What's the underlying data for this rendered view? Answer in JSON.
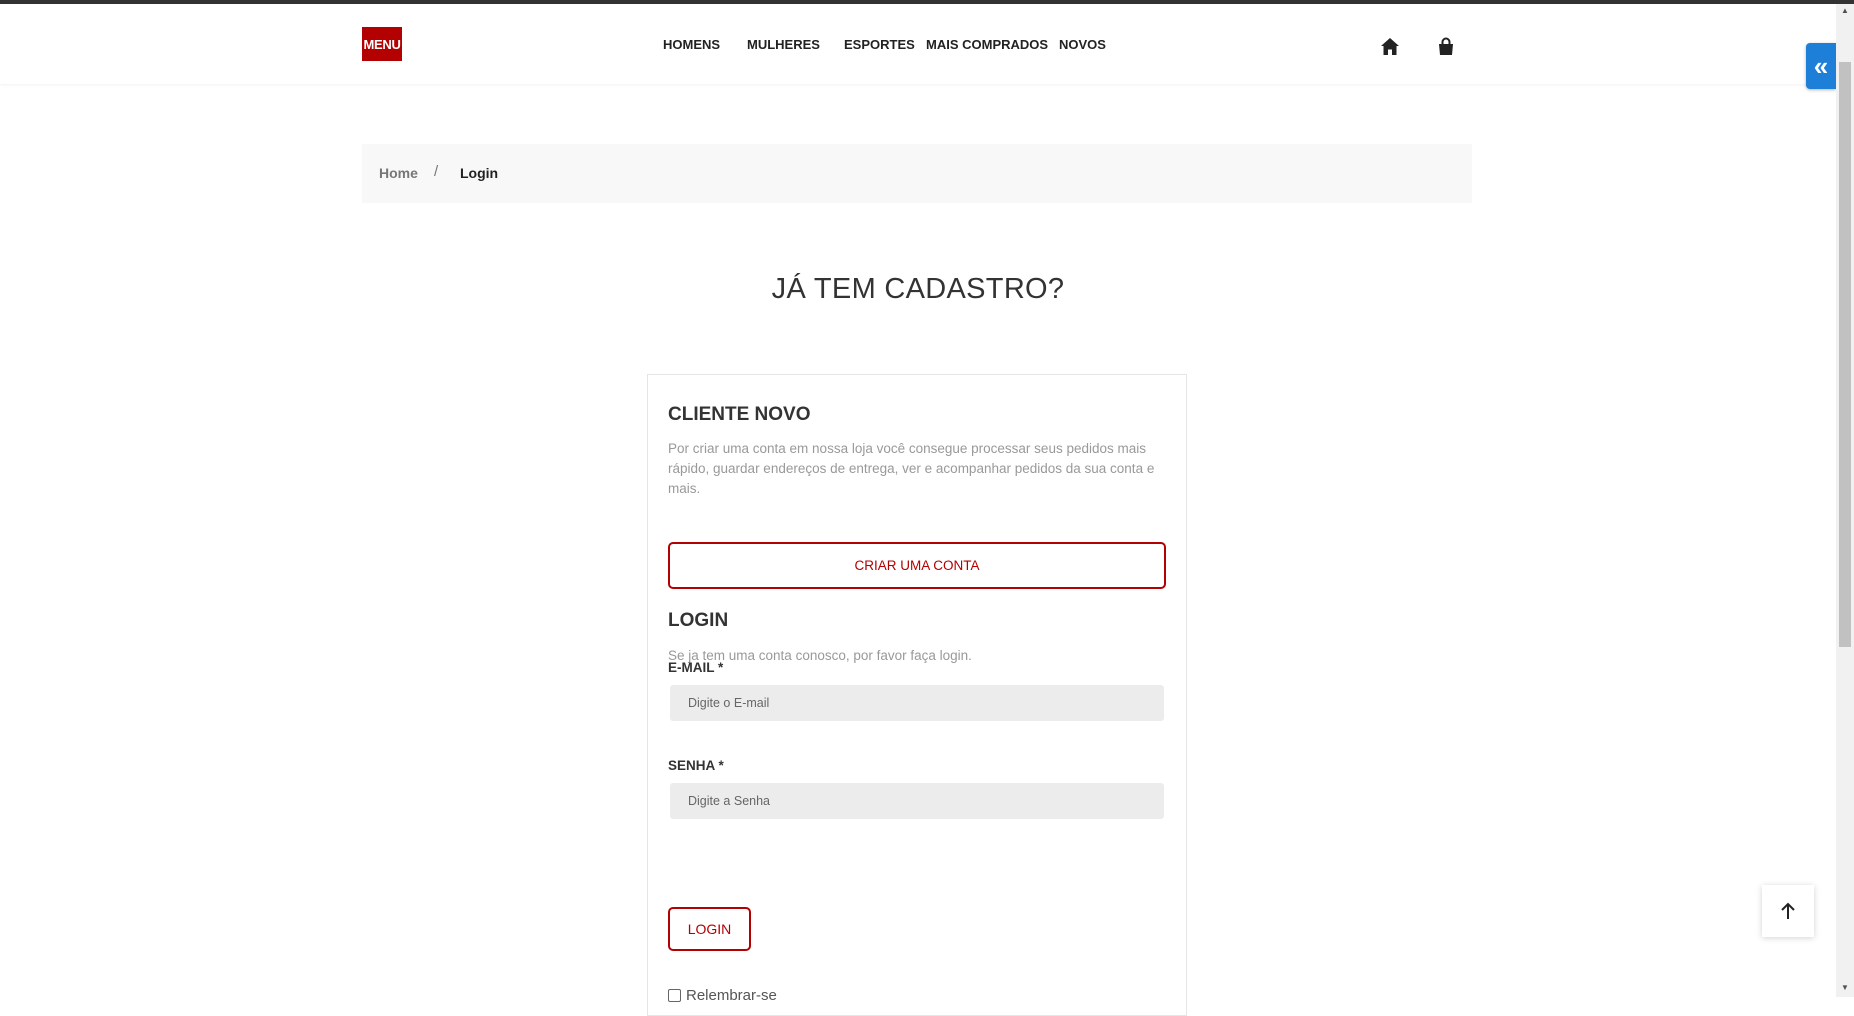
{
  "header": {
    "menu_label": "MENU",
    "nav": [
      "HOMENS",
      "MULHERES",
      "ESPORTES",
      "MAIS COMPRADOS",
      "NOVOS"
    ],
    "icons": [
      "home-icon",
      "shopping-bag-icon"
    ],
    "side_toggle_icon": "double-chevron-left-icon"
  },
  "breadcrumb": {
    "home": "Home",
    "separator": "/",
    "current": "Login"
  },
  "page_title": "JÁ TEM CADASTRO?",
  "new_customer": {
    "title": "CLIENTE NOVO",
    "description": "Por criar uma conta em nossa loja você consegue processar seus pedidos mais rápido, guardar endereços de entrega, ver e acompanhar pedidos da sua conta e mais.",
    "button": "CRIAR UMA CONTA"
  },
  "login": {
    "title": "LOGIN",
    "description": "Se ja tem uma conta conosco, por favor faça login.",
    "email_label": "E-MAIL *",
    "email_placeholder": "Digite o E-mail",
    "password_label": "SENHA *",
    "password_placeholder": "Digite a Senha",
    "button": "LOGIN",
    "remember_label": "Relembrar-se"
  },
  "back_to_top_icon": "arrow-up-icon",
  "colors": {
    "brand": "#b30000",
    "side_toggle": "#1e7fd8",
    "input_bg": "#ececec"
  }
}
